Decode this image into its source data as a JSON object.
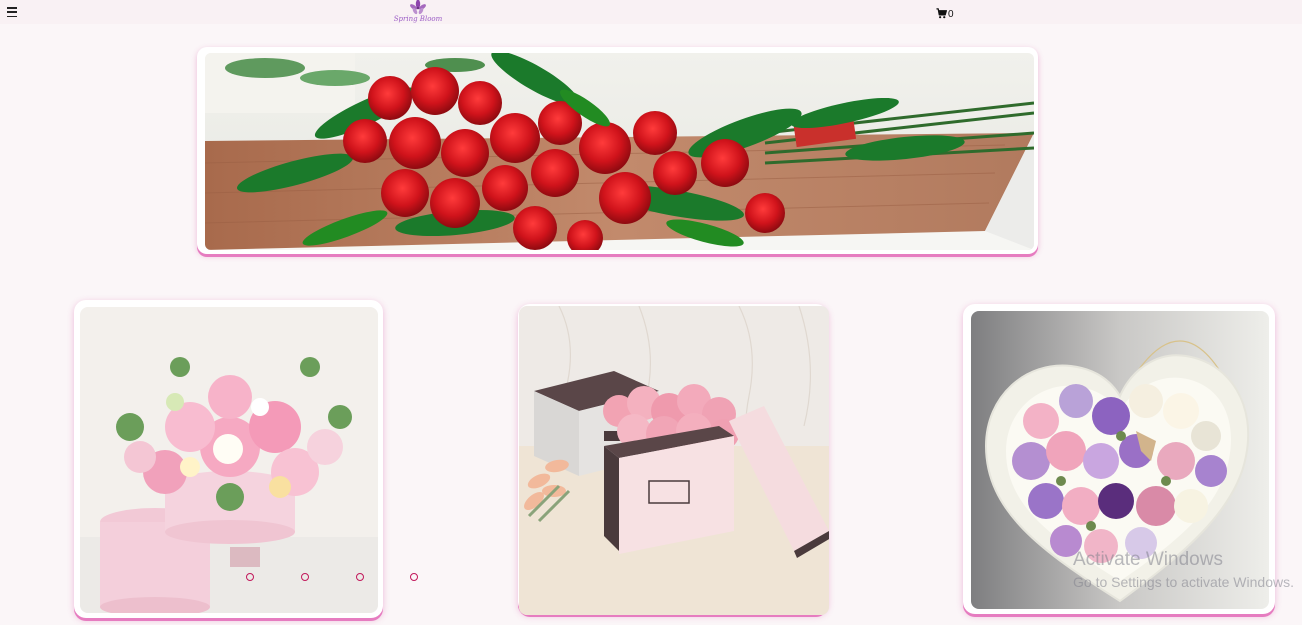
{
  "header": {
    "logo_text": "Spring Bloom",
    "cart_count": "0"
  },
  "hero": {
    "image": "red-roses-bouquet"
  },
  "products": [
    {
      "image": "pink-flower-box-arrangement"
    },
    {
      "image": "pink-roses-in-flower-box"
    },
    {
      "image": "heart-box-soap-roses"
    }
  ],
  "carousel": {
    "dot_count": 4
  },
  "watermark": {
    "title": "Activate Windows",
    "subtitle": "Go to Settings to activate Windows."
  },
  "colors": {
    "accent": "#e67cc0",
    "dot": "#c2185b",
    "background": "#fbf6f8"
  }
}
